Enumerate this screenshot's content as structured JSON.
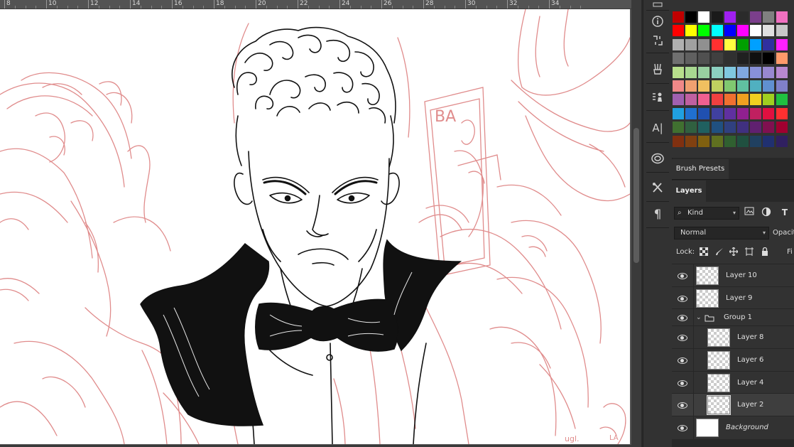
{
  "ruler": {
    "labels": [
      "8",
      "10",
      "12",
      "14",
      "16",
      "18",
      "20",
      "22",
      "24",
      "26",
      "28",
      "30",
      "32",
      "34"
    ]
  },
  "colors": {
    "sketch": "#e08c8c",
    "ink": "#111111",
    "ui_dark": "#323232",
    "ui_darker": "#282828",
    "active_row": "#3e3e3e"
  },
  "toolbar": {
    "icons": [
      "history-icon",
      "info-icon",
      "properties-icon",
      "brush-icon",
      "clone-source-icon",
      "character-icon",
      "libraries-icon",
      "tool-presets-icon",
      "paragraph-icon"
    ],
    "character_glyph": "A|",
    "paragraph_glyph": "¶"
  },
  "swatches": {
    "rows": [
      [
        "#c00000",
        "#000000",
        "#ffffff",
        "#1a1a1a",
        "#a020f0",
        "#2b2b2b",
        "#7b3f8c",
        "#808080",
        "#f070c0"
      ],
      [
        "#ff0000",
        "#ffff00",
        "#00ff00",
        "#00ffff",
        "#0000ff",
        "#ff00ff",
        "#ffffff",
        "#e0e0e0",
        "#c8c8c8"
      ],
      [
        "#b0b0b0",
        "#a0a0a0",
        "#909090",
        "#ff3030",
        "#ffff40",
        "#00a000",
        "#00a0ff",
        "#3030a0",
        "#ff20ff"
      ],
      [
        "#707070",
        "#606060",
        "#505050",
        "#404040",
        "#303030",
        "#202020",
        "#101010",
        "#000000",
        "#ff9a6a"
      ],
      [
        "#b8e08c",
        "#a8d890",
        "#98d0a0",
        "#8cd0c0",
        "#80c8e0",
        "#80a8e0",
        "#8890d8",
        "#9888d0",
        "#b888d0"
      ],
      [
        "#f08888",
        "#f0a070",
        "#f0c060",
        "#c0d060",
        "#80c870",
        "#60c0a0",
        "#50b0c0",
        "#6090d0",
        "#8080c8"
      ],
      [
        "#a060b0",
        "#c060a0",
        "#f06090",
        "#f04040",
        "#f07030",
        "#f0a020",
        "#f0d020",
        "#a0d020",
        "#20c040"
      ],
      [
        "#20a0e0",
        "#2070d0",
        "#2050b0",
        "#4040a0",
        "#6030a0",
        "#902090",
        "#c02060",
        "#e01040",
        "#ff3030"
      ],
      [
        "#407030",
        "#306040",
        "#206060",
        "#205080",
        "#304080",
        "#403080",
        "#602070",
        "#801050",
        "#a00030"
      ],
      [
        "#803010",
        "#804010",
        "#806010",
        "#607020",
        "#306030",
        "#205040",
        "#204060",
        "#203070",
        "#302060"
      ]
    ]
  },
  "brush_presets": {
    "label": "Brush Presets"
  },
  "layers": {
    "tab_label": "Layers",
    "filter_kind": "Kind",
    "blend_mode": "Normal",
    "opacity_label": "Opacity",
    "lock_label": "Lock:",
    "fill_label": "Fi",
    "filter_icons": [
      "image-filter-icon",
      "adjustment-filter-icon",
      "type-filter-icon"
    ],
    "type_glyph": "T",
    "items": [
      {
        "name": "Layer 10",
        "kind": "layer",
        "indent": 0,
        "visible": true,
        "selected": false
      },
      {
        "name": "Layer 9",
        "kind": "layer",
        "indent": 0,
        "visible": true,
        "selected": false
      },
      {
        "name": "Group 1",
        "kind": "group",
        "indent": 0,
        "visible": true,
        "selected": false
      },
      {
        "name": "Layer 8",
        "kind": "layer",
        "indent": 1,
        "visible": true,
        "selected": false
      },
      {
        "name": "Layer 6",
        "kind": "layer",
        "indent": 1,
        "visible": true,
        "selected": false
      },
      {
        "name": "Layer 4",
        "kind": "layer",
        "indent": 1,
        "visible": true,
        "selected": false
      },
      {
        "name": "Layer 2",
        "kind": "layer",
        "indent": 1,
        "visible": true,
        "selected": true
      },
      {
        "name": "Background",
        "kind": "background",
        "indent": 0,
        "visible": true,
        "selected": false
      }
    ]
  },
  "canvas": {
    "card_text": "BA",
    "signature": "ugl.",
    "corner_text": "LA"
  }
}
